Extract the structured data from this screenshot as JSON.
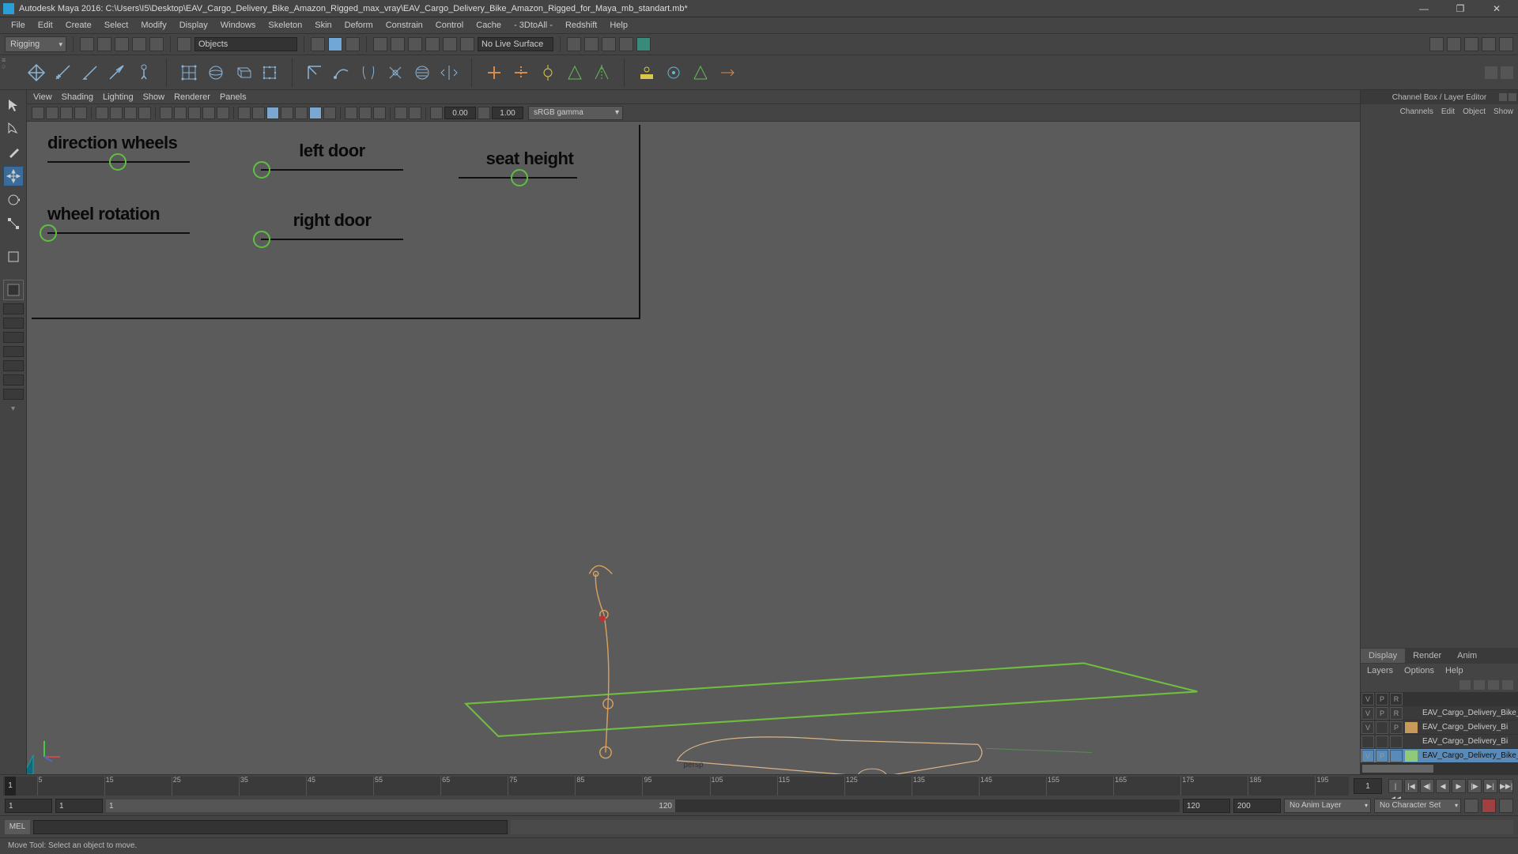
{
  "title": "Autodesk Maya 2016: C:\\Users\\I5\\Desktop\\EAV_Cargo_Delivery_Bike_Amazon_Rigged_max_vray\\EAV_Cargo_Delivery_Bike_Amazon_Rigged_for_Maya_mb_standart.mb*",
  "menus": [
    "File",
    "Edit",
    "Create",
    "Select",
    "Modify",
    "Display",
    "Windows",
    "Skeleton",
    "Skin",
    "Deform",
    "Constrain",
    "Control",
    "Cache",
    "- 3DtoAll -",
    "Redshift",
    "Help"
  ],
  "workspace_dd": "Rigging",
  "objects_field": "Objects",
  "live_surface": "No Live Surface",
  "vp_menus": [
    "View",
    "Shading",
    "Lighting",
    "Show",
    "Renderer",
    "Panels"
  ],
  "gamma_dd": "sRGB gamma",
  "vp_num1": "0.00",
  "vp_num2": "1.00",
  "camera_label": "persp",
  "rig": {
    "dir_wheels": "direction wheels",
    "wheel_rot": "wheel rotation",
    "left_door": "left door",
    "right_door": "right door",
    "seat_height": "seat height"
  },
  "rpanel_title": "Channel Box / Layer Editor",
  "rtabs": [
    "Channels",
    "Edit",
    "Object",
    "Show"
  ],
  "btabs": [
    "Display",
    "Render",
    "Anim"
  ],
  "lmenu": [
    "Layers",
    "Options",
    "Help"
  ],
  "layer_header": [
    "V",
    "P",
    "R"
  ],
  "layers": [
    {
      "v": "V",
      "p": "P",
      "r": "R",
      "color": "",
      "name": "EAV_Cargo_Delivery_Bike_Am",
      "sel": false
    },
    {
      "v": "V",
      "p": "",
      "r": "P",
      "color": "#c79a5a",
      "name": "EAV_Cargo_Delivery_Bi",
      "sel": false
    },
    {
      "v": "",
      "p": "",
      "r": "",
      "color": "",
      "name": "EAV_Cargo_Delivery_Bi",
      "sel": false
    },
    {
      "v": "V",
      "p": "P",
      "r": "",
      "color": "#8fc97a",
      "name": "EAV_Cargo_Delivery_Bike_A",
      "sel": true
    }
  ],
  "time": {
    "cur": "1",
    "start": "1",
    "end": "1",
    "ticks": [
      5,
      15,
      25,
      35,
      45,
      55,
      65,
      75,
      85,
      95,
      105,
      115,
      125,
      135,
      145,
      155,
      165,
      175,
      185,
      195
    ]
  },
  "range": {
    "start": "1",
    "in": "1",
    "shown_in": "1",
    "shown_out": "120",
    "out": "120",
    "end": "200"
  },
  "anim_layer_dd": "No Anim Layer",
  "char_set_dd": "No Character Set",
  "cmd_label": "MEL",
  "helpline": "Move Tool: Select an object to move."
}
